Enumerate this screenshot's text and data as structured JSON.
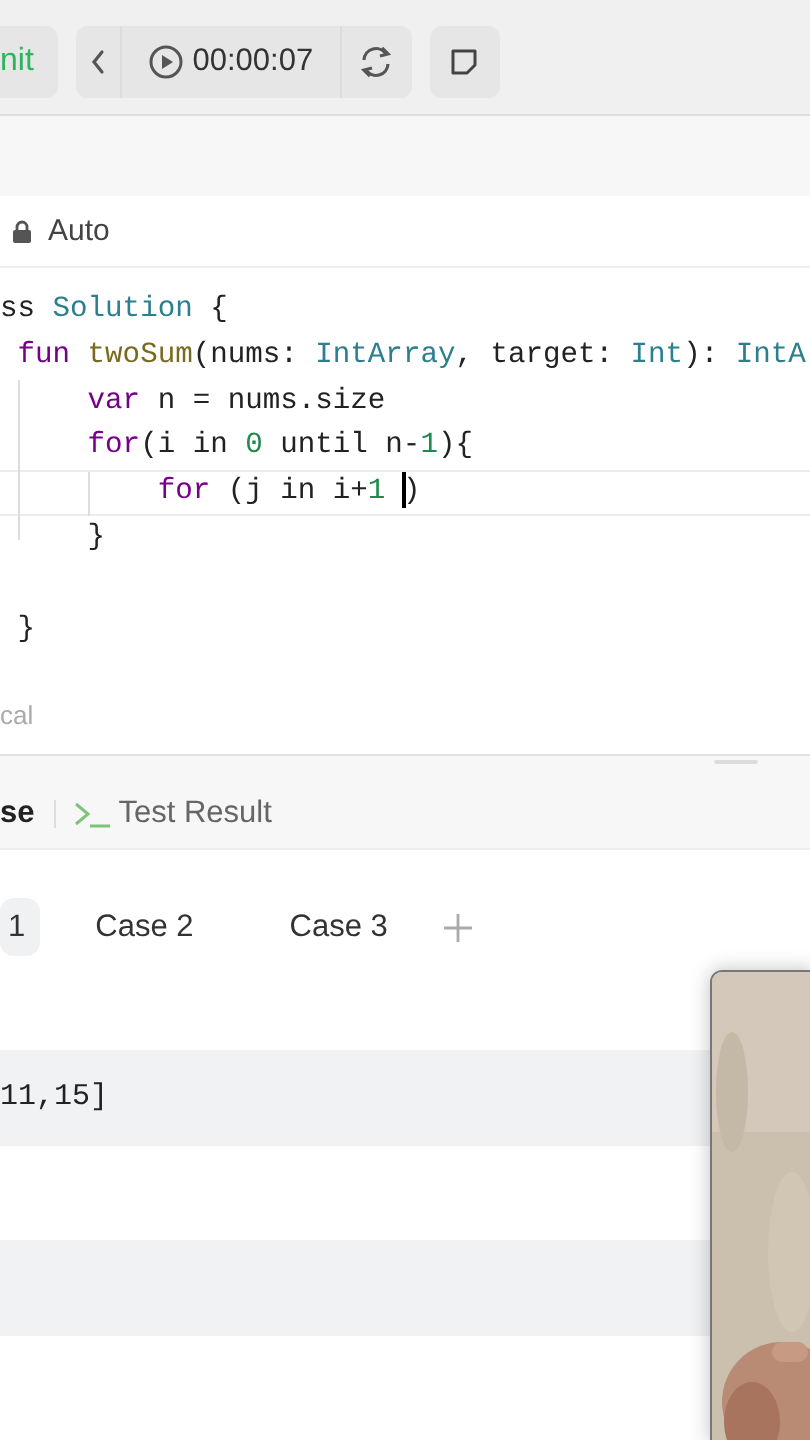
{
  "toolbar": {
    "submit": "nit",
    "timer": "00:00:07"
  },
  "editor": {
    "language": "Auto",
    "lines": [
      {
        "active": false,
        "tokens": [
          {
            "kind": "plain",
            "text": "ss "
          },
          {
            "kind": "type",
            "text": "Solution"
          },
          {
            "kind": "plain",
            "text": " {"
          }
        ]
      },
      {
        "active": false,
        "tokens": [
          {
            "kind": "keyword",
            "text": " fun "
          },
          {
            "kind": "function",
            "text": "twoSum"
          },
          {
            "kind": "plain",
            "text": "(nums: "
          },
          {
            "kind": "type",
            "text": "IntArray"
          },
          {
            "kind": "plain",
            "text": ", target: "
          },
          {
            "kind": "type",
            "text": "Int"
          },
          {
            "kind": "plain",
            "text": "): "
          },
          {
            "kind": "type",
            "text": "IntA"
          }
        ]
      },
      {
        "active": false,
        "tokens": [
          {
            "kind": "keyword",
            "text": "     var"
          },
          {
            "kind": "plain",
            "text": " n = nums.size"
          }
        ]
      },
      {
        "active": false,
        "tokens": [
          {
            "kind": "keyword",
            "text": "     for"
          },
          {
            "kind": "plain",
            "text": "(i in "
          },
          {
            "kind": "number",
            "text": "0"
          },
          {
            "kind": "plain",
            "text": " until n-"
          },
          {
            "kind": "number",
            "text": "1"
          },
          {
            "kind": "plain",
            "text": "){"
          }
        ]
      },
      {
        "active": true,
        "tokens": [
          {
            "kind": "keyword",
            "text": "         for"
          },
          {
            "kind": "plain",
            "text": " (j in i+"
          },
          {
            "kind": "number",
            "text": "1"
          },
          {
            "kind": "cursor"
          },
          {
            "kind": "plain",
            "text": ")"
          }
        ]
      },
      {
        "active": false,
        "tokens": [
          {
            "kind": "plain",
            "text": "     }"
          }
        ]
      },
      {
        "active": false
      },
      {
        "active": false,
        "tokens": [
          {
            "kind": "plain",
            "text": " }"
          }
        ]
      }
    ],
    "status": "cal"
  },
  "panel": {
    "tabs": [
      {
        "label": "se",
        "selected": true
      },
      {
        "label": "Test Result",
        "selected": false
      }
    ],
    "cases": [
      {
        "label": "1",
        "selected": true
      },
      {
        "label": "Case 2",
        "selected": false
      },
      {
        "label": "Case 3",
        "selected": false
      }
    ],
    "fields": [
      {
        "value": "11,15]",
        "focused": false
      },
      {
        "focused": false
      }
    ]
  }
}
